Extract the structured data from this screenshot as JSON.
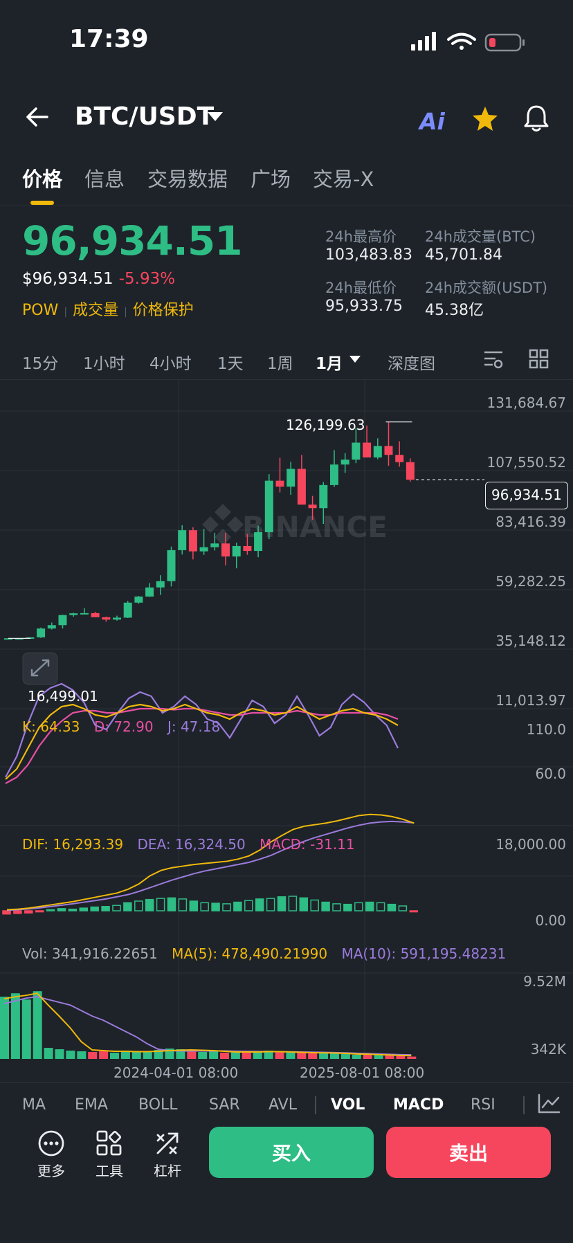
{
  "status": {
    "time": "17:39"
  },
  "header": {
    "pair": "BTC/USDT",
    "ai_label": "Ai"
  },
  "tabs": [
    "价格",
    "信息",
    "交易数据",
    "广场",
    "交易-X"
  ],
  "price": {
    "last": "96,934.51",
    "usd": "$96,934.51",
    "change": "-5.93%",
    "tags": [
      "POW",
      "成交量",
      "价格保护"
    ]
  },
  "stats": {
    "high_label": "24h最高价",
    "high": "103,483.83",
    "low_label": "24h最低价",
    "low": "95,933.75",
    "vol_btc_label": "24h成交量(BTC)",
    "vol_btc": "45,701.84",
    "vol_usdt_label": "24h成交额(USDT)",
    "vol_usdt": "45.38亿"
  },
  "intervals": [
    "15分",
    "1小时",
    "4小时",
    "1天",
    "1周",
    "1月",
    "深度图"
  ],
  "active_interval": "1月",
  "main_axis": [
    "131,684.67",
    "107,550.52",
    "83,416.39",
    "59,282.25",
    "35,148.12",
    "11,013.97"
  ],
  "markers": {
    "high": "126,199.63",
    "low": "16,499.01",
    "current": "96,934.51"
  },
  "watermark": "BINANCE",
  "kdj": {
    "k": "K: 64.33",
    "d": "D: 72.90",
    "j": "J: 47.18",
    "axis": [
      "110.0",
      "60.0"
    ]
  },
  "macd": {
    "dif": "DIF: 16,293.39",
    "dea": "DEA: 16,324.50",
    "macd": "MACD: -31.11",
    "axis": [
      "18,000.00",
      "0.00"
    ]
  },
  "vol": {
    "vol": "Vol: 341,916.22651",
    "ma5": "MA(5): 478,490.21990",
    "ma10": "MA(10): 591,195.48231",
    "axis": [
      "9.52M",
      "342K"
    ]
  },
  "time_axis": [
    "2024-04-01 08:00",
    "2025-08-01 08:00"
  ],
  "indicator_tabs": [
    "MA",
    "EMA",
    "BOLL",
    "SAR",
    "AVL",
    "VOL",
    "MACD",
    "RSI"
  ],
  "active_indicators": [
    "VOL",
    "MACD"
  ],
  "tools": [
    "更多",
    "工具",
    "杠杆"
  ],
  "actions": {
    "buy": "买入",
    "sell": "卖出"
  },
  "colors": {
    "up": "#2ebd85",
    "down": "#f6465d",
    "accent": "#f0b90b",
    "bg": "#1e2329"
  },
  "chart_data": {
    "type": "candlestick",
    "candles": [
      [
        16500,
        16600,
        16499.01,
        16550
      ],
      [
        16550,
        16650,
        16400,
        16600
      ],
      [
        16600,
        16800,
        16450,
        17000
      ],
      [
        17000,
        22000,
        16700,
        21500
      ],
      [
        21500,
        24500,
        21000,
        23200
      ],
      [
        23200,
        28500,
        21500,
        28300
      ],
      [
        28300,
        29500,
        27500,
        29200
      ],
      [
        29200,
        31800,
        28800,
        29300
      ],
      [
        29300,
        30000,
        27500,
        27200
      ],
      [
        27200,
        27500,
        25000,
        26000
      ],
      [
        26000,
        28000,
        25500,
        27000
      ],
      [
        27000,
        35500,
        26800,
        34600
      ],
      [
        34600,
        38000,
        34000,
        37700
      ],
      [
        37700,
        44500,
        37500,
        42300
      ],
      [
        42300,
        48500,
        38500,
        45500
      ],
      [
        45500,
        63000,
        42800,
        61200
      ],
      [
        61200,
        73800,
        59000,
        71300
      ],
      [
        71300,
        72800,
        56500,
        60600
      ],
      [
        60600,
        71900,
        58800,
        62700
      ],
      [
        62700,
        70000,
        61000,
        64600
      ],
      [
        64600,
        70000,
        53500,
        58000
      ],
      [
        58000,
        65000,
        52000,
        63300
      ],
      [
        63300,
        69500,
        58900,
        60800
      ],
      [
        60800,
        73600,
        57600,
        70300
      ],
      [
        70300,
        99700,
        66800,
        96400
      ],
      [
        96400,
        108000,
        90500,
        93400
      ],
      [
        93400,
        106000,
        89200,
        102400
      ],
      [
        102400,
        109500,
        91200,
        84300
      ],
      [
        84300,
        88700,
        76600,
        82500
      ],
      [
        82500,
        95700,
        74500,
        94200
      ],
      [
        94200,
        111900,
        93300,
        104600
      ],
      [
        104600,
        110400,
        100400,
        107100
      ],
      [
        107100,
        123200,
        105300,
        115700
      ],
      [
        115700,
        124400,
        111900,
        108200
      ],
      [
        108200,
        117900,
        107300,
        114000
      ],
      [
        114000,
        126199.63,
        104000,
        109500
      ],
      [
        109500,
        116400,
        103500,
        105800
      ],
      [
        105800,
        107700,
        95933.75,
        96934.51
      ]
    ]
  }
}
